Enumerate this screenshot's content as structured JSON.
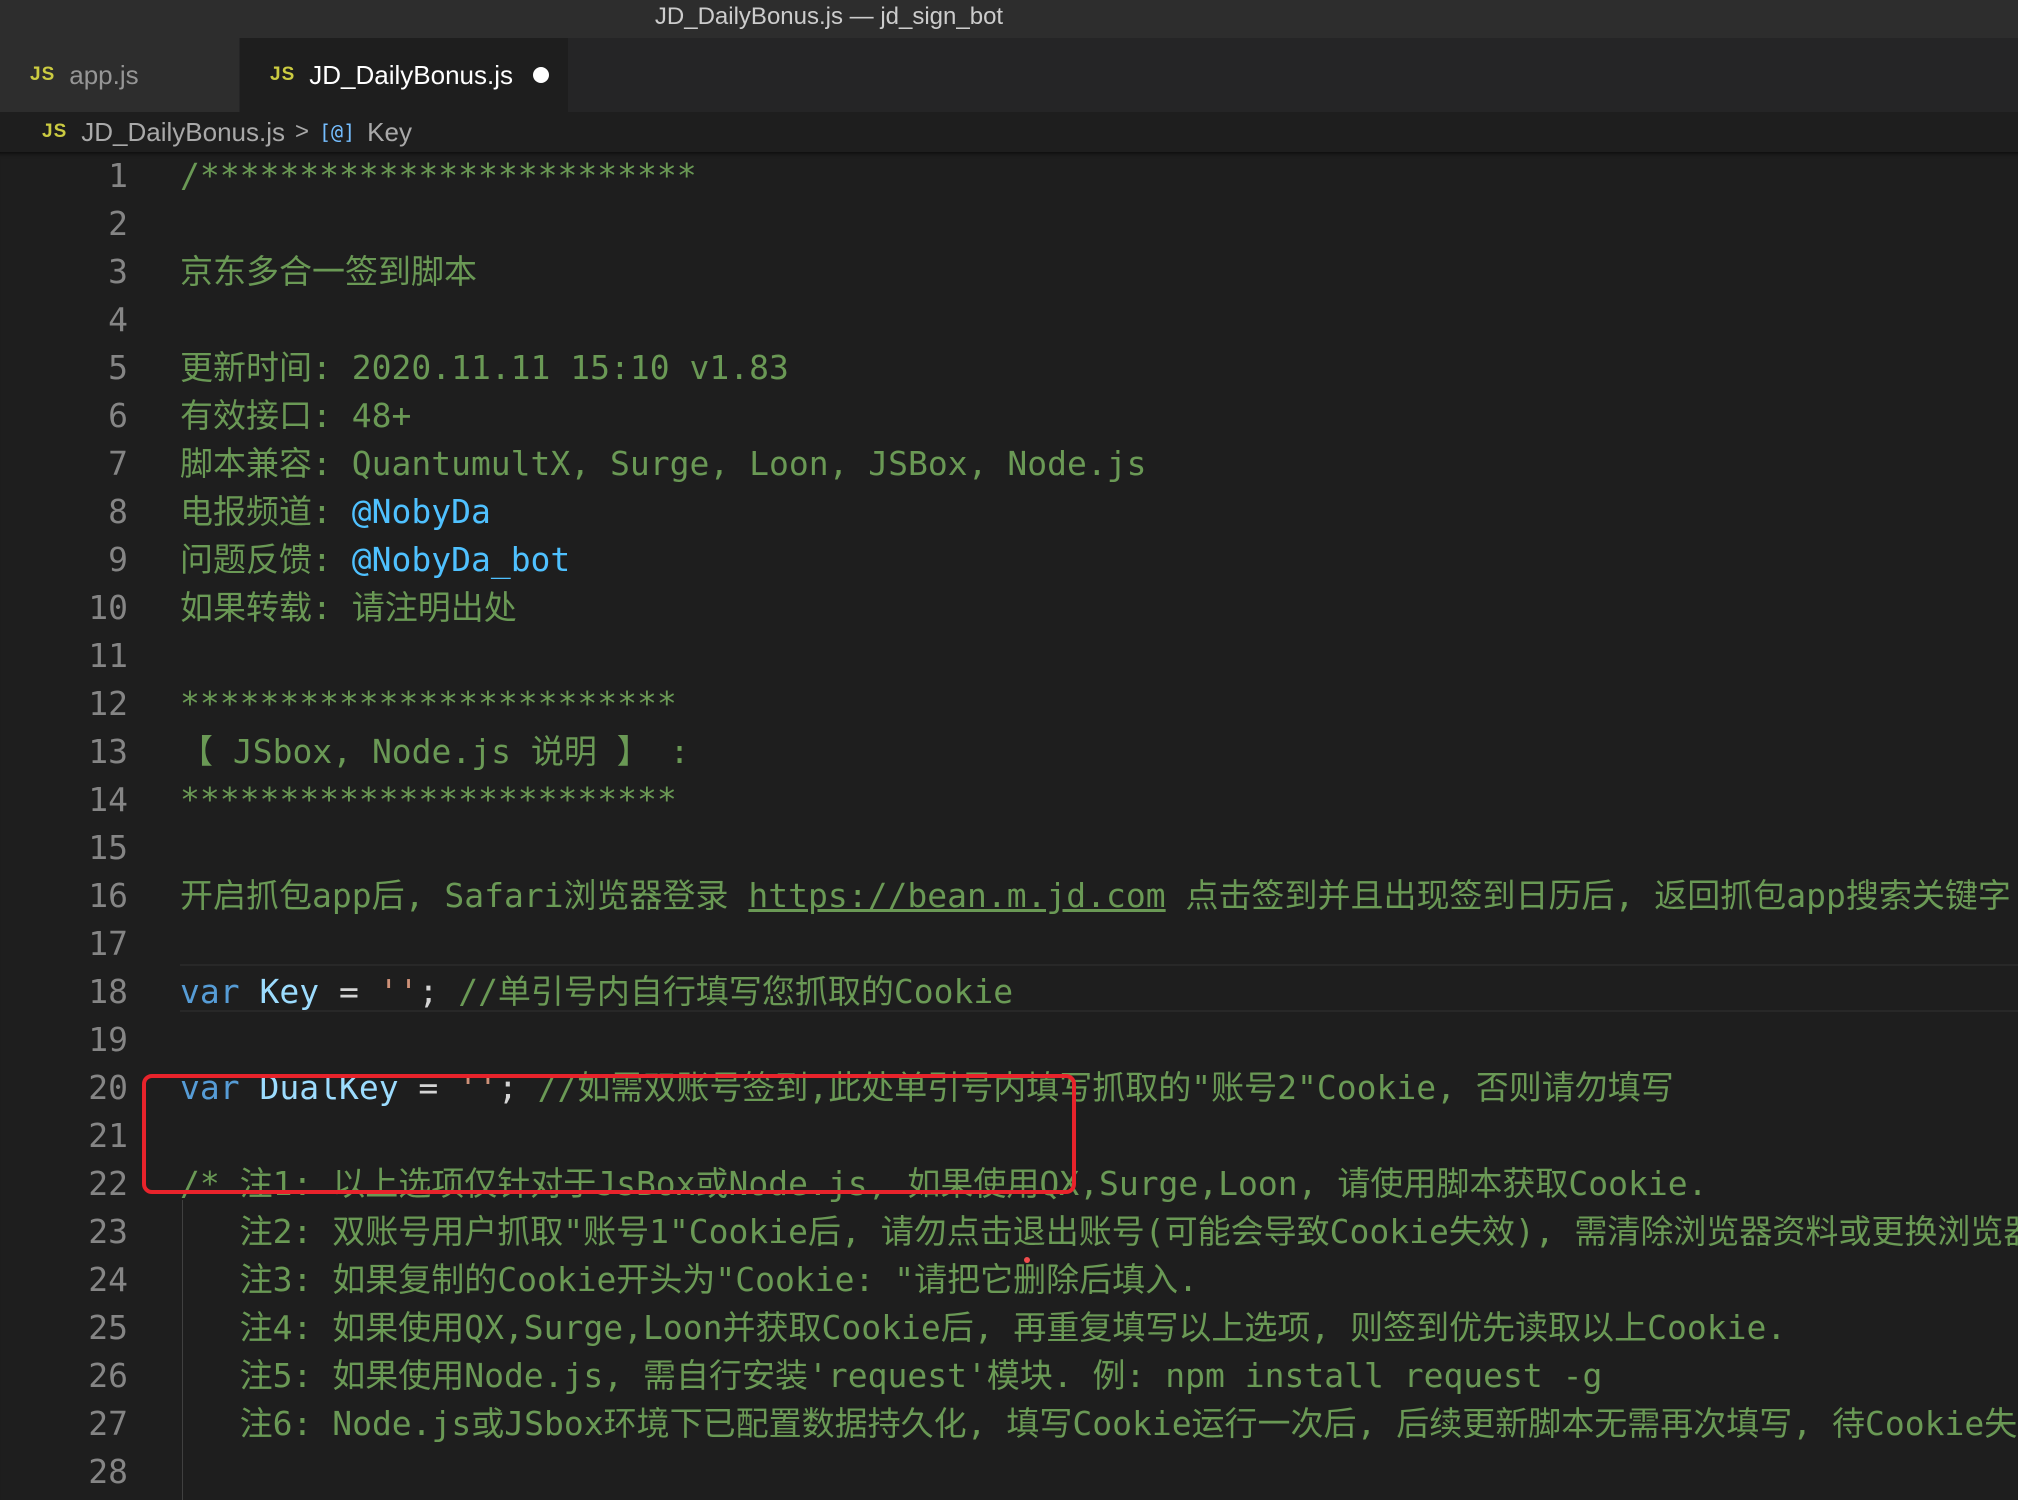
{
  "window": {
    "title": "JD_DailyBonus.js — jd_sign_bot"
  },
  "tabs": [
    {
      "icon": "JS",
      "label": "app.js"
    },
    {
      "icon": "JS",
      "label": "JD_DailyBonus.js"
    }
  ],
  "breadcrumb": {
    "icon": "JS",
    "file": "JD_DailyBonus.js",
    "separator": ">",
    "symbol_icon": "[@]",
    "symbol": "Key"
  },
  "code": {
    "l1": "/*************************",
    "l3": "京东多合一签到脚本",
    "l5": "更新时间: 2020.11.11 15:10 v1.83",
    "l6": "有效接口: 48+",
    "l7": "脚本兼容: QuantumultX, Surge, Loon, JSBox, Node.js",
    "l8_prefix": "电报频道: ",
    "l8_tag": "@NobyDa",
    "l9_prefix": "问题反馈: ",
    "l9_tag": "@NobyDa_bot",
    "l10": "如果转载: 请注明出处",
    "l12": "*************************",
    "l13": "【 JSbox, Node.js 说明 】 :",
    "l14": "*************************",
    "l16_prefix": "开启抓包app后, Safari浏览器登录 ",
    "l16_link": "https://bean.m.jd.com",
    "l16_suffix": " 点击签到并且出现签到日历后, 返回抓包app搜索关键字 fu",
    "l18_kw": "var",
    "l18_name": "Key",
    "l18_eq": " = ",
    "l18_str": "''",
    "l18_semi": ";",
    "l18_comment": " //单引号内自行填写您抓取的Cookie",
    "l20_kw": "var",
    "l20_name": "DualKey",
    "l20_eq": " = ",
    "l20_str": "''",
    "l20_semi": ";",
    "l20_comment": " //如需双账号签到,此处单引号内填写抓取的\"账号2\"Cookie, 否则请勿填写",
    "l22": "/* 注1: 以上选项仅针对于JsBox或Node.js, 如果使用QX,Surge,Loon, 请使用脚本获取Cookie.",
    "l23": "   注2: 双账号用户抓取\"账号1\"Cookie后, 请勿点击退出账号(可能会导致Cookie失效), 需清除浏览器资料或更换浏览器登",
    "l24": "   注3: 如果复制的Cookie开头为\"Cookie: \"请把它删除后填入.",
    "l25": "   注4: 如果使用QX,Surge,Loon并获取Cookie后, 再重复填写以上选项, 则签到优先读取以上Cookie.",
    "l26": "   注5: 如果使用Node.js, 需自行安装'request'模块. 例: npm install request -g",
    "l27": "   注6: Node.js或JSbox环境下已配置数据持久化, 填写Cookie运行一次后, 后续更新脚本无需再次填写, 待Cookie失效后"
  },
  "line_numbers": [
    "1",
    "2",
    "3",
    "4",
    "5",
    "6",
    "7",
    "8",
    "9",
    "10",
    "11",
    "12",
    "13",
    "14",
    "15",
    "16",
    "17",
    "18",
    "19",
    "20",
    "21",
    "22",
    "23",
    "24",
    "25",
    "26",
    "27",
    "28"
  ],
  "colors": {
    "highlight_box": "#e8232b",
    "comment": "#6a9955",
    "keyword": "#569cd6",
    "variable": "#9cdcfe",
    "string": "#ce9178"
  }
}
